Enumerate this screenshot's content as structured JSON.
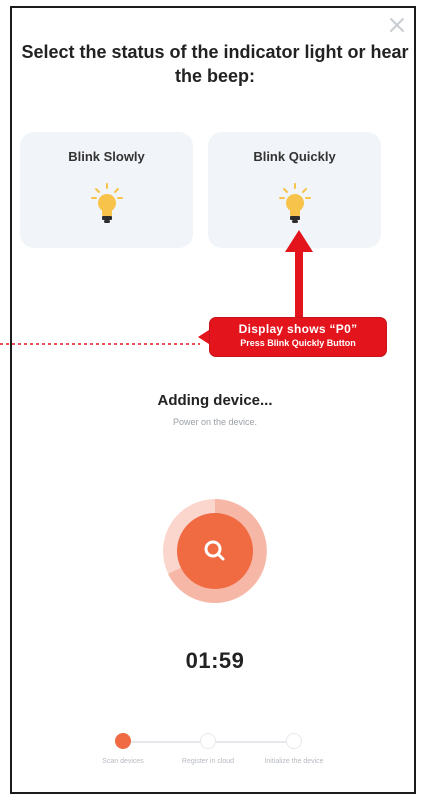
{
  "dialog": {
    "title": "Select the status of the indicator light or hear the beep:"
  },
  "options": [
    {
      "label": "Blink Slowly"
    },
    {
      "label": "Blink Quickly"
    }
  ],
  "callout": {
    "line1": "Display shows “P0”",
    "line2": "Press Blink Quickly Button",
    "color": "#e3141c"
  },
  "status": {
    "title": "Adding device...",
    "hint": "Power on the device."
  },
  "timer": "01:59",
  "steps": [
    {
      "label": "Scan devices"
    },
    {
      "label": "Register in cloud"
    },
    {
      "label": "Initialize the device"
    }
  ],
  "colors": {
    "accent": "#f06a42",
    "accent_light": "#f7b7a6",
    "bulb": "#f7c34a"
  }
}
